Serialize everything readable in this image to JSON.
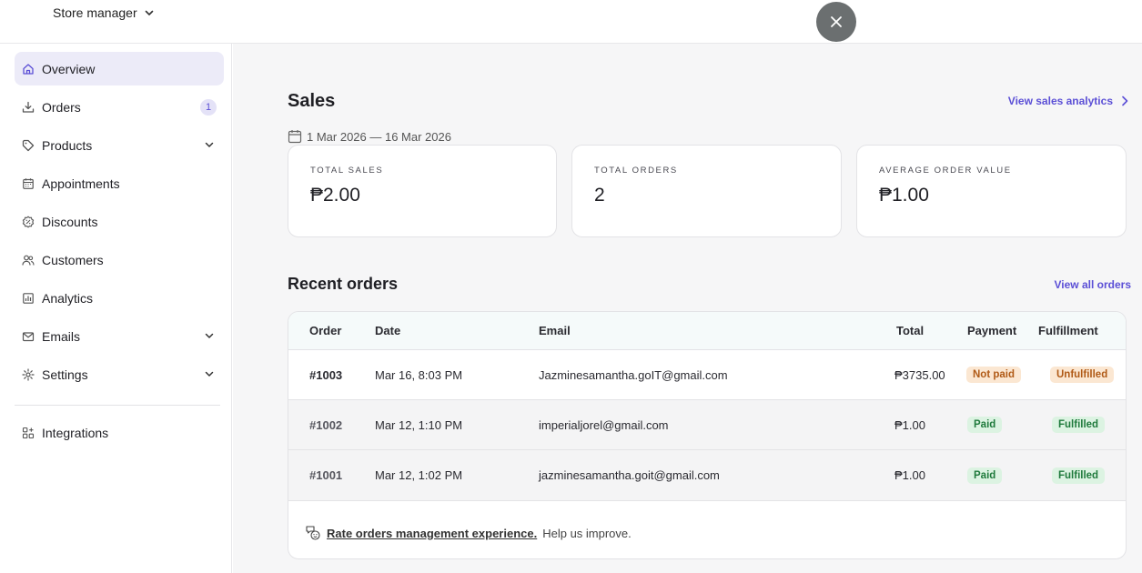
{
  "header": {
    "store_name": "Store manager"
  },
  "sidebar": {
    "items": [
      {
        "label": "Overview"
      },
      {
        "label": "Orders",
        "badge": "1"
      },
      {
        "label": "Products"
      },
      {
        "label": "Appointments"
      },
      {
        "label": "Discounts"
      },
      {
        "label": "Customers"
      },
      {
        "label": "Analytics"
      },
      {
        "label": "Emails"
      },
      {
        "label": "Settings"
      },
      {
        "label": "Integrations"
      }
    ]
  },
  "sales": {
    "title": "Sales",
    "view_link": "View sales analytics",
    "date_range": "1 Mar 2026 — 16 Mar 2026",
    "stats": [
      {
        "label": "TOTAL SALES",
        "value": "₱2.00"
      },
      {
        "label": "TOTAL ORDERS",
        "value": "2"
      },
      {
        "label": "AVERAGE ORDER VALUE",
        "value": "₱1.00"
      }
    ]
  },
  "orders": {
    "title": "Recent orders",
    "view_link": "View all orders",
    "columns": [
      "Order",
      "Date",
      "Email",
      "Total",
      "Payment",
      "Fulfillment"
    ],
    "rows": [
      {
        "order": "#1003",
        "date": "Mar 16, 8:03 PM",
        "email": "Jazminesamantha.goIT@gmail.com",
        "total": "₱3735.00",
        "payment": "Not paid",
        "fulfillment": "Unfulfilled"
      },
      {
        "order": "#1002",
        "date": "Mar 12, 1:10 PM",
        "email": "imperialjorel@gmail.com",
        "total": "₱1.00",
        "payment": "Paid",
        "fulfillment": "Fulfilled"
      },
      {
        "order": "#1001",
        "date": "Mar 12, 1:02 PM",
        "email": "jazminesamantha.goit@gmail.com",
        "total": "₱1.00",
        "payment": "Paid",
        "fulfillment": "Fulfilled"
      }
    ],
    "feedback_link": "Rate orders management experience.",
    "feedback_text": "Help us improve."
  },
  "colors": {
    "accent": "#5b4fd6",
    "active_bg": "#ecebf8",
    "warn_bg": "#fbe7d2",
    "ok_bg": "#dcf3e2"
  }
}
